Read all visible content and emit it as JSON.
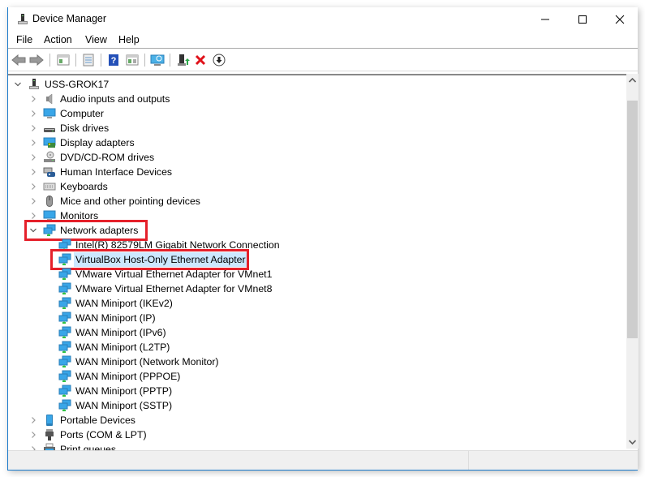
{
  "window": {
    "title": "Device Manager",
    "controls": {
      "minimize": "minimize",
      "maximize": "maximize",
      "close": "close"
    }
  },
  "menu": [
    "File",
    "Action",
    "View",
    "Help"
  ],
  "toolbar": {
    "buttons": [
      {
        "name": "back-button",
        "icon": "arrow-left-icon"
      },
      {
        "name": "forward-button",
        "icon": "arrow-right-icon"
      },
      {
        "name": "show-hide-console-tree-button",
        "icon": "console-tree-icon"
      },
      {
        "name": "properties-button",
        "icon": "properties-icon"
      },
      {
        "name": "help-button",
        "icon": "help-icon"
      },
      {
        "name": "show-action-pane-button",
        "icon": "action-pane-icon"
      },
      {
        "name": "scan-hardware-button",
        "icon": "scan-monitor-icon"
      },
      {
        "name": "update-driver-button",
        "icon": "update-driver-icon"
      },
      {
        "name": "uninstall-device-button",
        "icon": "red-x-icon"
      },
      {
        "name": "disable-device-button",
        "icon": "down-arrow-circle-icon"
      }
    ]
  },
  "tree": {
    "root": {
      "label": "USS-GROK17",
      "expanded": true,
      "icon": "computer-tower-icon"
    },
    "categories": [
      {
        "label": "Audio inputs and outputs",
        "icon": "speaker-icon",
        "expanded": false
      },
      {
        "label": "Computer",
        "icon": "monitor-icon",
        "expanded": false
      },
      {
        "label": "Disk drives",
        "icon": "disk-drive-icon",
        "expanded": false
      },
      {
        "label": "Display adapters",
        "icon": "display-adapter-icon",
        "expanded": false
      },
      {
        "label": "DVD/CD-ROM drives",
        "icon": "dvd-drive-icon",
        "expanded": false
      },
      {
        "label": "Human Interface Devices",
        "icon": "hid-icon",
        "expanded": false
      },
      {
        "label": "Keyboards",
        "icon": "keyboard-icon",
        "expanded": false
      },
      {
        "label": "Mice and other pointing devices",
        "icon": "mouse-icon",
        "expanded": false
      },
      {
        "label": "Monitors",
        "icon": "monitor-icon",
        "expanded": false
      },
      {
        "label": "Network adapters",
        "icon": "network-adapter-icon",
        "expanded": true,
        "highlighted": true,
        "children": [
          {
            "label": "Intel(R) 82579LM Gigabit Network Connection"
          },
          {
            "label": "VirtualBox Host-Only Ethernet Adapter",
            "selected": true,
            "highlighted": true
          },
          {
            "label": "VMware Virtual Ethernet Adapter for VMnet1"
          },
          {
            "label": "VMware Virtual Ethernet Adapter for VMnet8"
          },
          {
            "label": "WAN Miniport (IKEv2)"
          },
          {
            "label": "WAN Miniport (IP)"
          },
          {
            "label": "WAN Miniport (IPv6)"
          },
          {
            "label": "WAN Miniport (L2TP)"
          },
          {
            "label": "WAN Miniport (Network Monitor)"
          },
          {
            "label": "WAN Miniport (PPPOE)"
          },
          {
            "label": "WAN Miniport (PPTP)"
          },
          {
            "label": "WAN Miniport (SSTP)"
          }
        ]
      },
      {
        "label": "Portable Devices",
        "icon": "portable-device-icon",
        "expanded": false
      },
      {
        "label": "Ports (COM & LPT)",
        "icon": "port-icon",
        "expanded": false
      },
      {
        "label": "Print queues",
        "icon": "printer-icon",
        "expanded": false
      }
    ]
  },
  "scrollbar": {
    "position_fraction": 0.04,
    "visible_fraction": 0.68
  },
  "colors": {
    "highlight_box": "#e5202a",
    "selection": "#cce8ff",
    "accent": "#1979ca"
  }
}
